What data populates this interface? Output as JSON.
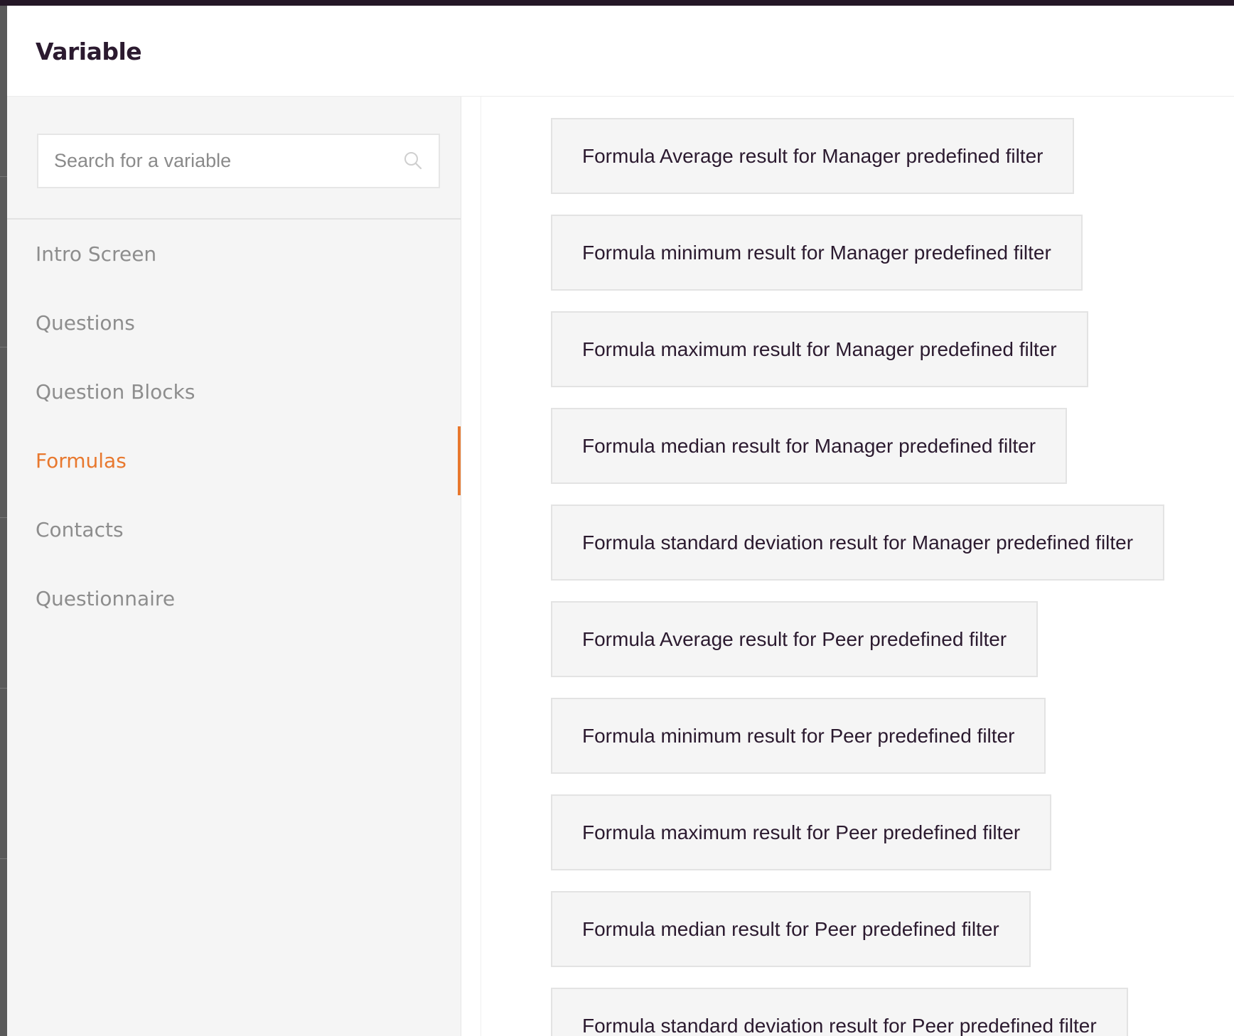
{
  "modal": {
    "title": "Variable"
  },
  "search": {
    "placeholder": "Search for a variable",
    "value": ""
  },
  "sidebar": {
    "items": [
      {
        "label": "Intro Screen",
        "active": false
      },
      {
        "label": "Questions",
        "active": false
      },
      {
        "label": "Question Blocks",
        "active": false
      },
      {
        "label": "Formulas",
        "active": true
      },
      {
        "label": "Contacts",
        "active": false
      },
      {
        "label": "Questionnaire",
        "active": false
      }
    ]
  },
  "variables": [
    "Formula Average result for Manager predefined filter",
    "Formula minimum result for Manager predefined filter",
    "Formula maximum result for Manager predefined filter",
    "Formula median result for Manager predefined filter",
    "Formula standard deviation result for Manager predefined filter",
    "Formula Average result for Peer predefined filter",
    "Formula minimum result for Peer predefined filter",
    "Formula maximum result for Peer predefined filter",
    "Formula median result for Peer predefined filter",
    "Formula standard deviation result for Peer predefined filter"
  ],
  "colors": {
    "accent": "#e8782e",
    "title_text": "#2b1a2f",
    "nav_text": "#8d8d8d",
    "sidebar_bg": "#f5f5f5"
  },
  "icons": {
    "search": "search-icon"
  }
}
